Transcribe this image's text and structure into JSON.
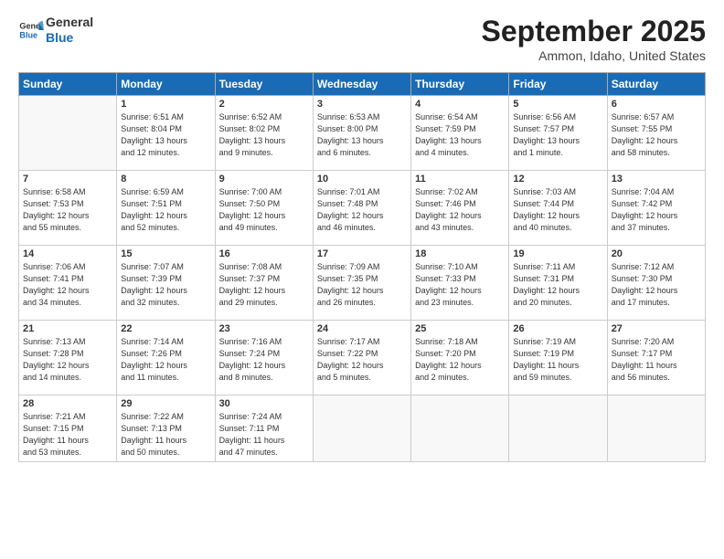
{
  "logo": {
    "line1": "General",
    "line2": "Blue"
  },
  "title": "September 2025",
  "location": "Ammon, Idaho, United States",
  "days_header": [
    "Sunday",
    "Monday",
    "Tuesday",
    "Wednesday",
    "Thursday",
    "Friday",
    "Saturday"
  ],
  "weeks": [
    [
      {
        "day": "",
        "info": ""
      },
      {
        "day": "1",
        "info": "Sunrise: 6:51 AM\nSunset: 8:04 PM\nDaylight: 13 hours\nand 12 minutes."
      },
      {
        "day": "2",
        "info": "Sunrise: 6:52 AM\nSunset: 8:02 PM\nDaylight: 13 hours\nand 9 minutes."
      },
      {
        "day": "3",
        "info": "Sunrise: 6:53 AM\nSunset: 8:00 PM\nDaylight: 13 hours\nand 6 minutes."
      },
      {
        "day": "4",
        "info": "Sunrise: 6:54 AM\nSunset: 7:59 PM\nDaylight: 13 hours\nand 4 minutes."
      },
      {
        "day": "5",
        "info": "Sunrise: 6:56 AM\nSunset: 7:57 PM\nDaylight: 13 hours\nand 1 minute."
      },
      {
        "day": "6",
        "info": "Sunrise: 6:57 AM\nSunset: 7:55 PM\nDaylight: 12 hours\nand 58 minutes."
      }
    ],
    [
      {
        "day": "7",
        "info": "Sunrise: 6:58 AM\nSunset: 7:53 PM\nDaylight: 12 hours\nand 55 minutes."
      },
      {
        "day": "8",
        "info": "Sunrise: 6:59 AM\nSunset: 7:51 PM\nDaylight: 12 hours\nand 52 minutes."
      },
      {
        "day": "9",
        "info": "Sunrise: 7:00 AM\nSunset: 7:50 PM\nDaylight: 12 hours\nand 49 minutes."
      },
      {
        "day": "10",
        "info": "Sunrise: 7:01 AM\nSunset: 7:48 PM\nDaylight: 12 hours\nand 46 minutes."
      },
      {
        "day": "11",
        "info": "Sunrise: 7:02 AM\nSunset: 7:46 PM\nDaylight: 12 hours\nand 43 minutes."
      },
      {
        "day": "12",
        "info": "Sunrise: 7:03 AM\nSunset: 7:44 PM\nDaylight: 12 hours\nand 40 minutes."
      },
      {
        "day": "13",
        "info": "Sunrise: 7:04 AM\nSunset: 7:42 PM\nDaylight: 12 hours\nand 37 minutes."
      }
    ],
    [
      {
        "day": "14",
        "info": "Sunrise: 7:06 AM\nSunset: 7:41 PM\nDaylight: 12 hours\nand 34 minutes."
      },
      {
        "day": "15",
        "info": "Sunrise: 7:07 AM\nSunset: 7:39 PM\nDaylight: 12 hours\nand 32 minutes."
      },
      {
        "day": "16",
        "info": "Sunrise: 7:08 AM\nSunset: 7:37 PM\nDaylight: 12 hours\nand 29 minutes."
      },
      {
        "day": "17",
        "info": "Sunrise: 7:09 AM\nSunset: 7:35 PM\nDaylight: 12 hours\nand 26 minutes."
      },
      {
        "day": "18",
        "info": "Sunrise: 7:10 AM\nSunset: 7:33 PM\nDaylight: 12 hours\nand 23 minutes."
      },
      {
        "day": "19",
        "info": "Sunrise: 7:11 AM\nSunset: 7:31 PM\nDaylight: 12 hours\nand 20 minutes."
      },
      {
        "day": "20",
        "info": "Sunrise: 7:12 AM\nSunset: 7:30 PM\nDaylight: 12 hours\nand 17 minutes."
      }
    ],
    [
      {
        "day": "21",
        "info": "Sunrise: 7:13 AM\nSunset: 7:28 PM\nDaylight: 12 hours\nand 14 minutes."
      },
      {
        "day": "22",
        "info": "Sunrise: 7:14 AM\nSunset: 7:26 PM\nDaylight: 12 hours\nand 11 minutes."
      },
      {
        "day": "23",
        "info": "Sunrise: 7:16 AM\nSunset: 7:24 PM\nDaylight: 12 hours\nand 8 minutes."
      },
      {
        "day": "24",
        "info": "Sunrise: 7:17 AM\nSunset: 7:22 PM\nDaylight: 12 hours\nand 5 minutes."
      },
      {
        "day": "25",
        "info": "Sunrise: 7:18 AM\nSunset: 7:20 PM\nDaylight: 12 hours\nand 2 minutes."
      },
      {
        "day": "26",
        "info": "Sunrise: 7:19 AM\nSunset: 7:19 PM\nDaylight: 11 hours\nand 59 minutes."
      },
      {
        "day": "27",
        "info": "Sunrise: 7:20 AM\nSunset: 7:17 PM\nDaylight: 11 hours\nand 56 minutes."
      }
    ],
    [
      {
        "day": "28",
        "info": "Sunrise: 7:21 AM\nSunset: 7:15 PM\nDaylight: 11 hours\nand 53 minutes."
      },
      {
        "day": "29",
        "info": "Sunrise: 7:22 AM\nSunset: 7:13 PM\nDaylight: 11 hours\nand 50 minutes."
      },
      {
        "day": "30",
        "info": "Sunrise: 7:24 AM\nSunset: 7:11 PM\nDaylight: 11 hours\nand 47 minutes."
      },
      {
        "day": "",
        "info": ""
      },
      {
        "day": "",
        "info": ""
      },
      {
        "day": "",
        "info": ""
      },
      {
        "day": "",
        "info": ""
      }
    ]
  ]
}
